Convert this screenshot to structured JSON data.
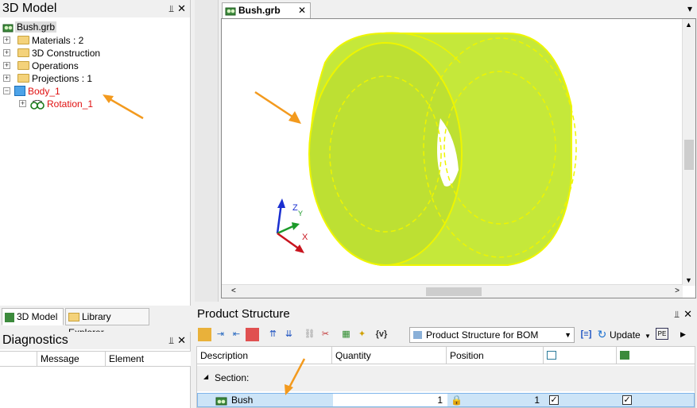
{
  "left_panel": {
    "title": "3D Model",
    "pin": "⫫",
    "close": "✕",
    "tree": {
      "root": "Bush.grb",
      "items": [
        {
          "label": "Materials : 2"
        },
        {
          "label": "3D Construction"
        },
        {
          "label": "Operations"
        },
        {
          "label": "Projections : 1"
        },
        {
          "label": "Body_1"
        },
        {
          "label": "Rotation_1"
        }
      ]
    }
  },
  "left_tabs": [
    {
      "label": "3D Model"
    },
    {
      "label": "Library Explorer"
    }
  ],
  "diagnostics": {
    "title": "Diagnostics",
    "columns": [
      "",
      "Message",
      "Element"
    ]
  },
  "document": {
    "tab_label": "Bush.grb",
    "tab_close": "✕",
    "menu_arrow": "▾",
    "axes": {
      "x": "X",
      "y": "Y",
      "z": "Z"
    },
    "colors": {
      "body": "#c5e83a",
      "edge": "#eef500",
      "arrow": "#f39a1e"
    }
  },
  "product_structure": {
    "title": "Product Structure",
    "combo_value": "Product Structure for BOM",
    "variables_label": "{v}",
    "update_label": "Update",
    "columns": [
      "Description",
      "Quantity",
      "Position"
    ],
    "section_label": "Section:",
    "row": {
      "description": "Bush",
      "quantity": "1",
      "position": "1"
    }
  }
}
